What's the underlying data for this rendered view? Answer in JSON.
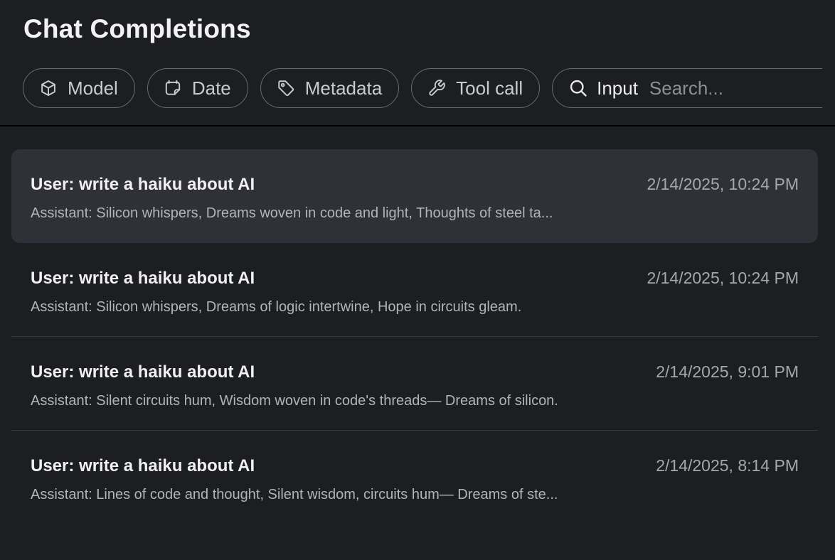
{
  "page": {
    "title": "Chat Completions"
  },
  "filters": [
    {
      "label": "Model",
      "icon": "cube-icon"
    },
    {
      "label": "Date",
      "icon": "calendar-icon"
    },
    {
      "label": "Metadata",
      "icon": "tag-icon"
    },
    {
      "label": "Tool call",
      "icon": "wrench-icon"
    }
  ],
  "search": {
    "label": "Input",
    "placeholder": "Search...",
    "value": "",
    "icon": "search-icon"
  },
  "completions": [
    {
      "user": "User: write a haiku about AI",
      "assistant": "Assistant: Silicon whispers, Dreams woven in code and light, Thoughts of steel ta...",
      "date": "2/14/2025, 10:24 PM",
      "selected": true
    },
    {
      "user": "User: write a haiku about AI",
      "assistant": "Assistant: Silicon whispers, Dreams of logic intertwine, Hope in circuits gleam.",
      "date": "2/14/2025, 10:24 PM",
      "selected": false
    },
    {
      "user": "User: write a haiku about AI",
      "assistant": "Assistant: Silent circuits hum, Wisdom woven in code's threads— Dreams of silicon.",
      "date": "2/14/2025, 9:01 PM",
      "selected": false
    },
    {
      "user": "User: write a haiku about AI",
      "assistant": "Assistant: Lines of code and thought, Silent wisdom, circuits hum— Dreams of ste...",
      "date": "2/14/2025, 8:14 PM",
      "selected": false
    }
  ],
  "colors": {
    "background": "#1d1e21",
    "selected_row": "#2f3038",
    "chip_border": "#6a6b70",
    "muted_text": "#a6a7ad"
  }
}
